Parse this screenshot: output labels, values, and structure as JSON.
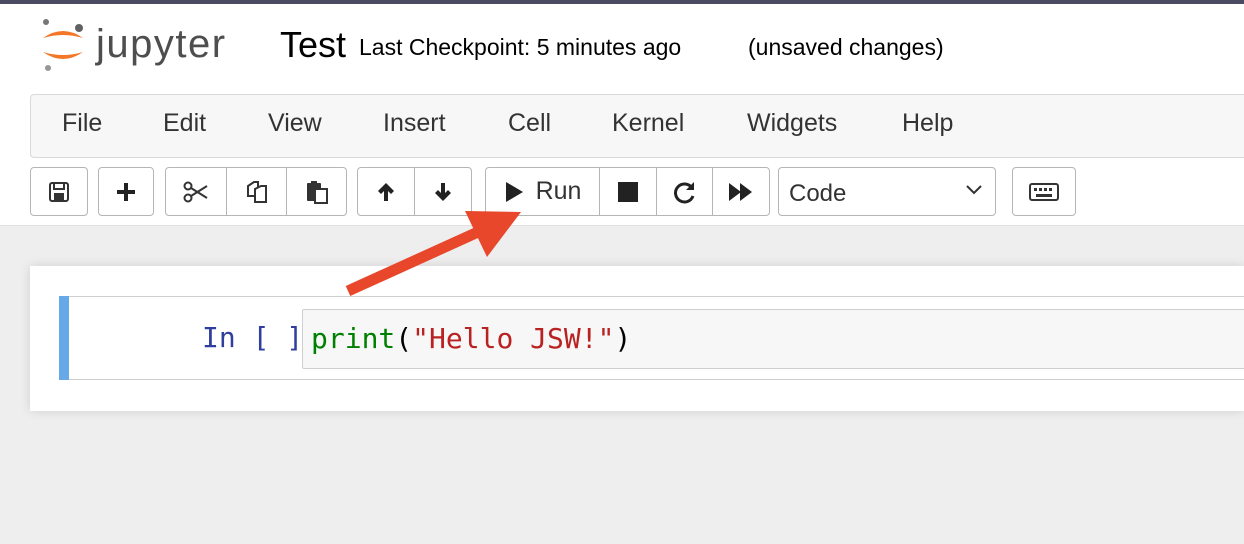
{
  "header": {
    "logo_text": "jupyter",
    "notebook_title": "Test",
    "checkpoint": "Last Checkpoint: 5 minutes ago",
    "status": "(unsaved changes)"
  },
  "menu": {
    "items": [
      "File",
      "Edit",
      "View",
      "Insert",
      "Cell",
      "Kernel",
      "Widgets",
      "Help"
    ]
  },
  "toolbar": {
    "run_label": "Run",
    "cell_type": "Code",
    "icons": [
      "save-icon",
      "plus-icon",
      "cut-icon",
      "copy-icon",
      "paste-icon",
      "arrow-up-icon",
      "arrow-down-icon",
      "play-icon",
      "stop-icon",
      "restart-icon",
      "fast-forward-icon",
      "keyboard-icon"
    ]
  },
  "cell": {
    "prompt": "In [ ]:",
    "code_builtin": "print",
    "code_open": "(",
    "code_string": "\"Hello JSW!\"",
    "code_close": ")"
  },
  "annotation": {
    "arrow_color": "#e8472b"
  },
  "colors": {
    "cell_selected_bar": "#66a8e8",
    "logo_orange": "#f37726"
  }
}
